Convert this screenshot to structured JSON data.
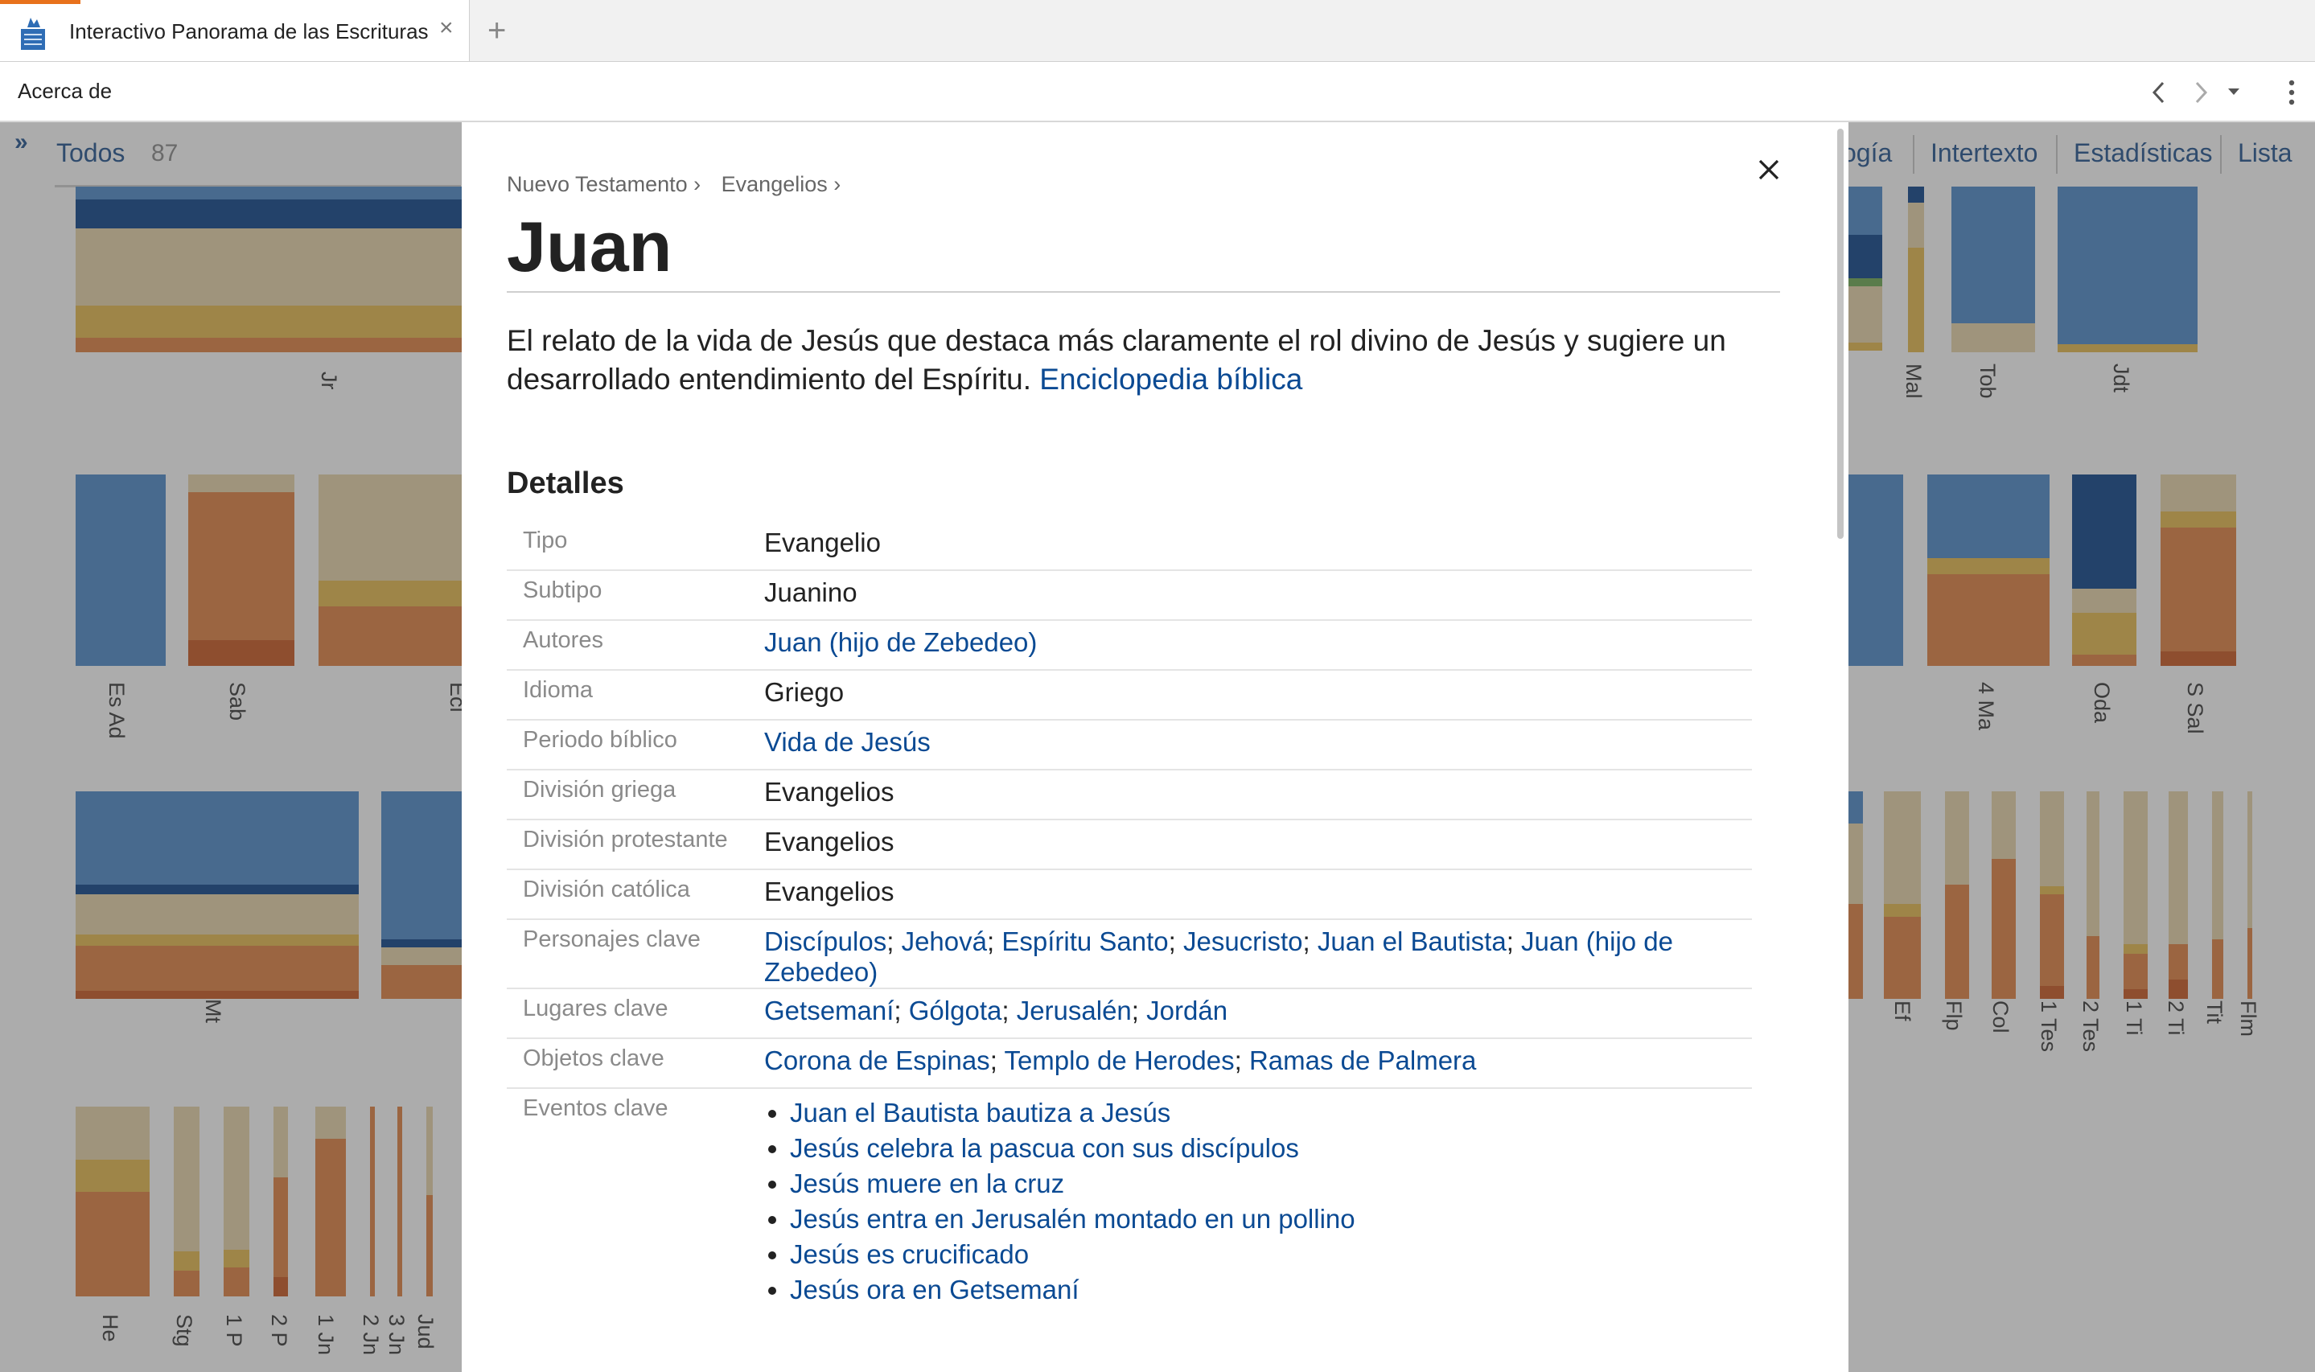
{
  "browser": {
    "tab_title": "Interactivo Panorama de las Escrituras",
    "tab_close": "×",
    "new_tab": "+"
  },
  "toolbar": {
    "about": "Acerca de",
    "back_icon": "chevron-left-icon",
    "forward_icon": "chevron-right-icon",
    "dropdown_icon": "caret-down-icon",
    "menu_icon": "more-vertical-icon"
  },
  "background_app": {
    "expand_icon": "»",
    "filter_label": "Todos",
    "filter_count": "87",
    "view_tabs": [
      "ogía",
      "Intertexto",
      "Estadísticas",
      "Lista"
    ],
    "book_labels": [
      "Jr",
      "Mal",
      "Tob",
      "Jdt",
      "Es Ad",
      "Sab",
      "Ecl",
      "4 Ma",
      "Oda",
      "S Sal",
      "Mt",
      "Ef",
      "Flp",
      "Col",
      "1 Tes",
      "2 Tes",
      "1 Ti",
      "2 Ti",
      "Tit",
      "Flm",
      "He",
      "Stg",
      "1 P",
      "2 P",
      "1 Jn",
      "2 Jn",
      "3 Jn",
      "Jud"
    ]
  },
  "colors": {
    "link": "#0b4a93",
    "dark_blue": "#073f88",
    "mid_blue": "#4a87c9",
    "tan": "#e8d4a8",
    "gold": "#e6b84a",
    "orange": "#e07e3c",
    "dark_orange": "#c9541d"
  },
  "modal": {
    "breadcrumb": [
      "Nuevo Testamento ›",
      "Evangelios ›"
    ],
    "close_icon": "close-icon",
    "title": "Juan",
    "description": "El relato de la vida de Jesús que destaca más claramente el rol divino de Jesús y sugiere un desarrollado entendimiento del Espíritu.",
    "description_link": "Enciclopedia bíblica",
    "details_heading": "Detalles",
    "details": {
      "tipo": {
        "label": "Tipo",
        "value": "Evangelio"
      },
      "subtipo": {
        "label": "Subtipo",
        "value": "Juanino"
      },
      "autores": {
        "label": "Autores",
        "links": [
          "Juan (hijo de Zebedeo)"
        ]
      },
      "idioma": {
        "label": "Idioma",
        "value": "Griego"
      },
      "periodo": {
        "label": "Periodo bíblico",
        "links": [
          "Vida de Jesús"
        ]
      },
      "div_griega": {
        "label": "División griega",
        "value": "Evangelios"
      },
      "div_protestante": {
        "label": "División protestante",
        "value": "Evangelios"
      },
      "div_catolica": {
        "label": "División católica",
        "value": "Evangelios"
      },
      "personajes": {
        "label": "Personajes clave",
        "links": [
          "Discípulos",
          "Jehová",
          "Espíritu Santo",
          "Jesucristo",
          "Juan el Bautista",
          "Juan (hijo de Zebedeo)"
        ]
      },
      "lugares": {
        "label": "Lugares clave",
        "links": [
          "Getsemaní",
          "Gólgota",
          "Jerusalén",
          "Jordán"
        ]
      },
      "objetos": {
        "label": "Objetos clave",
        "links": [
          "Corona de Espinas",
          "Templo de Herodes",
          "Ramas de Palmera"
        ]
      },
      "eventos": {
        "label": "Eventos clave",
        "items": [
          "Juan el Bautista bautiza a Jesús",
          "Jesús celebra la pascua con sus discípulos",
          "Jesús muere en la cruz",
          "Jesús entra en Jerusalén montado en un pollino",
          "Jesús es crucificado",
          "Jesús ora en Getsemaní"
        ]
      }
    }
  }
}
